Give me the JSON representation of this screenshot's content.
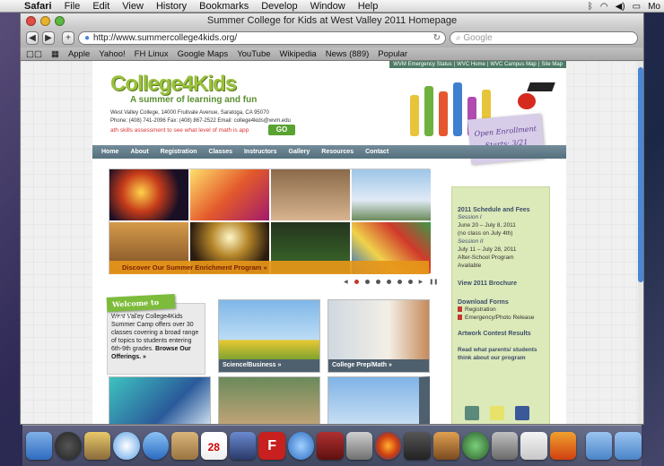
{
  "menubar": {
    "app": "Safari",
    "items": [
      "File",
      "Edit",
      "View",
      "History",
      "Bookmarks",
      "Develop",
      "Window",
      "Help"
    ],
    "right_partial": "Mo"
  },
  "window": {
    "title": "Summer College for Kids at West Valley 2011 Homepage"
  },
  "toolbar": {
    "url": "http://www.summercollege4kids.org/",
    "search_placeholder": "Google",
    "back": "◀",
    "fwd": "▶",
    "add": "+"
  },
  "bookmarks": [
    "Apple",
    "Yahoo!",
    "FH Linux",
    "Google Maps",
    "YouTube",
    "Wikipedia",
    "News (889)",
    "Popular"
  ],
  "site": {
    "toplinks": [
      "WVM Emergency Status",
      "WVC Home",
      "WVC Campus Map",
      "Site Map"
    ],
    "logo": "College4Kids",
    "tagline": "A summer of learning and fun",
    "address": "West Valley College, 14000 Fruitvale Avenue, Saratoga, CA 95070",
    "contact": "Phone: (408) 741-2096 Fax: (408) 867-2522 Email: college4kids@wvm.edu",
    "math": "ath skills assessment to see what level of math is app",
    "go": "GO",
    "enroll_line1": "Open Enrollment",
    "enroll_line2": "Starts: 3/21",
    "nav": [
      "Home",
      "About",
      "Registration",
      "Classes",
      "Instructors",
      "Gallery",
      "Resources",
      "Contact"
    ],
    "slider_caption": "Discover Our Summer Enrichment Program »",
    "welcome_tab": "Welcome to 2011 !",
    "welcome_text": "West Valley College4Kids Summer Camp offers over 30 classes covering a broad range of topics to students entering 6th-9th grades.",
    "welcome_link": "Browse Our Offerings. »",
    "tiles": [
      {
        "label": "Science/Business »"
      },
      {
        "label": "College Prep/Math »"
      },
      {
        "label": ""
      },
      {
        "label": ""
      },
      {
        "label": ""
      }
    ],
    "sidebar": {
      "schedule_head": "2011 Schedule and Fees",
      "session1": "Session I",
      "s1_dates": "June 20 – July 8, 2011",
      "s1_note": "(no class on July 4th)",
      "session2": "Session II",
      "s2_dates": "July 11 – July 28, 2011",
      "after": "After-School Program",
      "avail": "Available",
      "brochure": "View 2011 Brochure",
      "forms": "Download Forms",
      "reg": "Registration",
      "emerg": "Emergency/Photo Release",
      "contest": "Artwork Contest Results",
      "parents": "Read what parents/ students think about our program"
    }
  },
  "colors": {
    "nav": "#5d7886",
    "accent": "#9ac13b",
    "caption": "#e6961a",
    "sidebar": "#dce9b8",
    "scroll": "#4a86d6"
  }
}
